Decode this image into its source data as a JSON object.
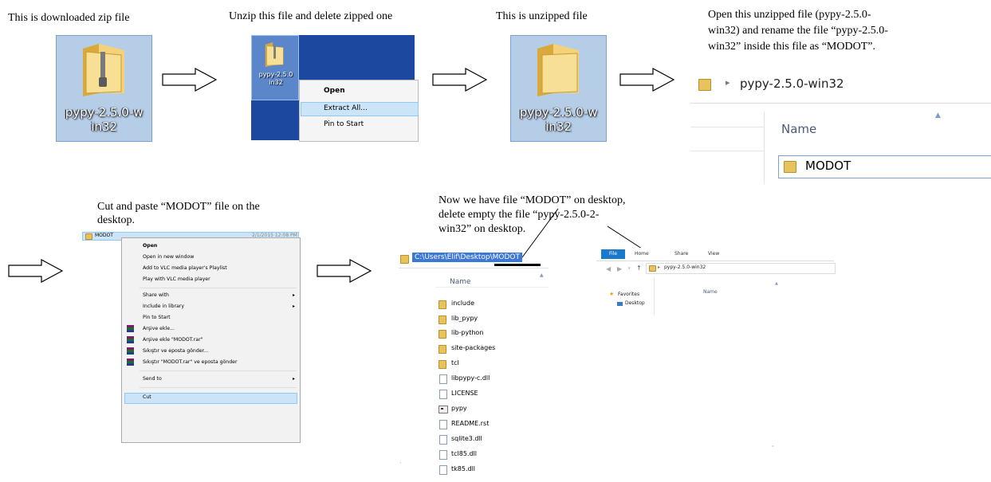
{
  "captions": {
    "c1": "This is downloaded zip file",
    "c2": "Unzip this file and delete zipped one",
    "c3": "This is unzipped file",
    "c4": [
      "Open this unzipped file (pypy-2.5.0-",
      "win32) and rename the file “pypy-2.5.0-",
      "win32” inside this file as “MODOT”."
    ],
    "c5": [
      "Cut and paste “MODOT” file on the",
      "desktop."
    ],
    "c6": [
      "Now we have file “MODOT” on desktop,",
      "delete empty the file “pypy-2.5.0-2-",
      "win32” on desktop."
    ]
  },
  "icon1": {
    "label_line1": "pypy-2.5.0-w",
    "label_line2": "in32",
    "icon": "zip-folder-icon"
  },
  "icon3": {
    "label_line1": "pypy-2.5.0-w",
    "label_line2": "in32",
    "icon": "folder-icon"
  },
  "ctx1": {
    "icon_label_1": "pypy-2.5.0",
    "icon_label_2": "in32",
    "items": [
      "Open",
      "Extract All...",
      "Pin to Start"
    ]
  },
  "explorer1": {
    "path": "pypy-2.5.0-win32",
    "column_name": "Name",
    "item": "MODOT"
  },
  "ctx2": {
    "file_name": "MODOT",
    "file_date": "2/1/2015 12:08 PM",
    "items": [
      "Open",
      "Open in new window",
      "Add to VLC media player's Playlist",
      "Play with VLC media player",
      "Share with",
      "Include in library",
      "Pin to Start",
      "Arşive ekle...",
      "Arşive ekle \"MODOT.rar\"",
      "Sıkıştır ve eposta gönder...",
      "Sıkıştır \"MODOT.rar\" ve eposta gönder",
      "Send to",
      "Cut"
    ]
  },
  "explorer2": {
    "path": "C:\\Users\\Elif\\Desktop\\MODOT",
    "column_name": "Name",
    "files": [
      "include",
      "lib_pypy",
      "lib-python",
      "site-packages",
      "tcl",
      "libpypy-c.dll",
      "LICENSE",
      "pypy",
      "README.rst",
      "sqlite3.dll",
      "tcl85.dll",
      "tk85.dll"
    ]
  },
  "explorer3": {
    "tabs": [
      "File",
      "Home",
      "Share",
      "View"
    ],
    "path": "pypy-2.5.0-win32",
    "column_name": "Name",
    "nav": [
      "Favorites",
      "Desktop"
    ]
  },
  "colors": {
    "selection": "#cce4f7",
    "desktop_blue": "#1c48a0",
    "file_tab": "#1979ca",
    "folder": "#e8c25c"
  }
}
